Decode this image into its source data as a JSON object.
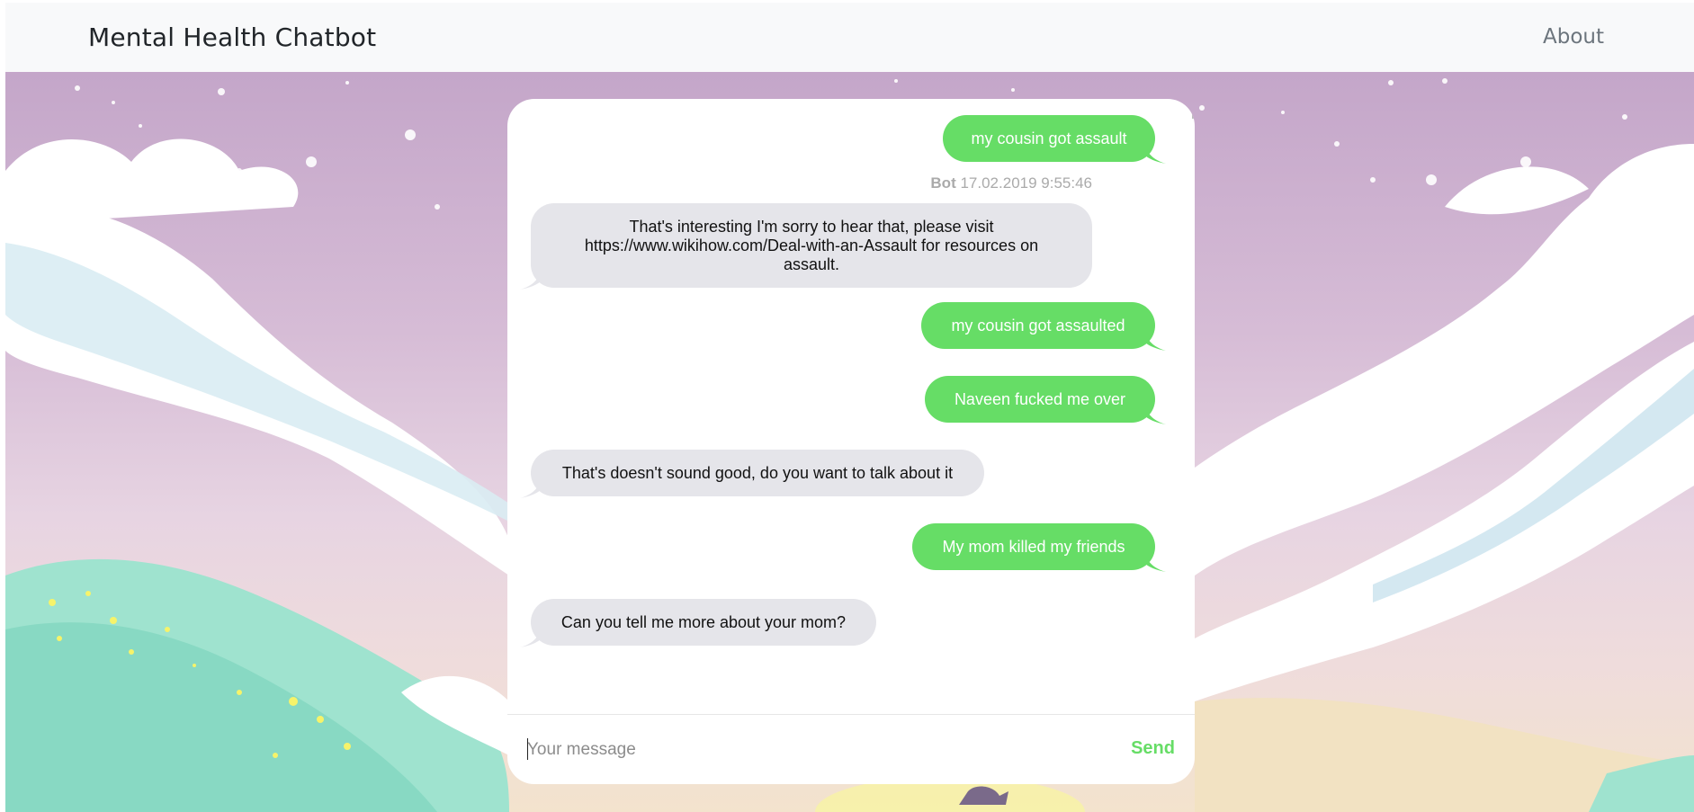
{
  "navbar": {
    "brand": "Mental Health Chatbot",
    "about": "About"
  },
  "chat": {
    "bot_meta": {
      "name": "Bot",
      "timestamp": "17.02.2019  9:55:46"
    },
    "messages": [
      {
        "from": "user",
        "text": "my cousin got assault"
      },
      {
        "from": "bot",
        "text": "That's interesting I'm sorry to hear that, please visit https://www.wikihow.com/Deal-with-an-Assault for resources on assault."
      },
      {
        "from": "user",
        "text": "my cousin got assaulted"
      },
      {
        "from": "user",
        "text": "Naveen fucked me over"
      },
      {
        "from": "bot",
        "text": "That's doesn't sound good, do you want to talk about it"
      },
      {
        "from": "user",
        "text": "My mom killed my friends"
      },
      {
        "from": "bot",
        "text": "Can you tell me more about your mom?"
      }
    ],
    "input": {
      "placeholder": "Your message",
      "value": ""
    },
    "send_label": "Send"
  },
  "colors": {
    "user_bubble": "#66dd66",
    "bot_bubble": "#e5e5ea",
    "navbar_bg": "#f8f9fa",
    "send_text": "#66dd66"
  },
  "icons": {
    "user_tail": "speech-bubble-tail-right",
    "bot_tail": "speech-bubble-tail-left"
  }
}
